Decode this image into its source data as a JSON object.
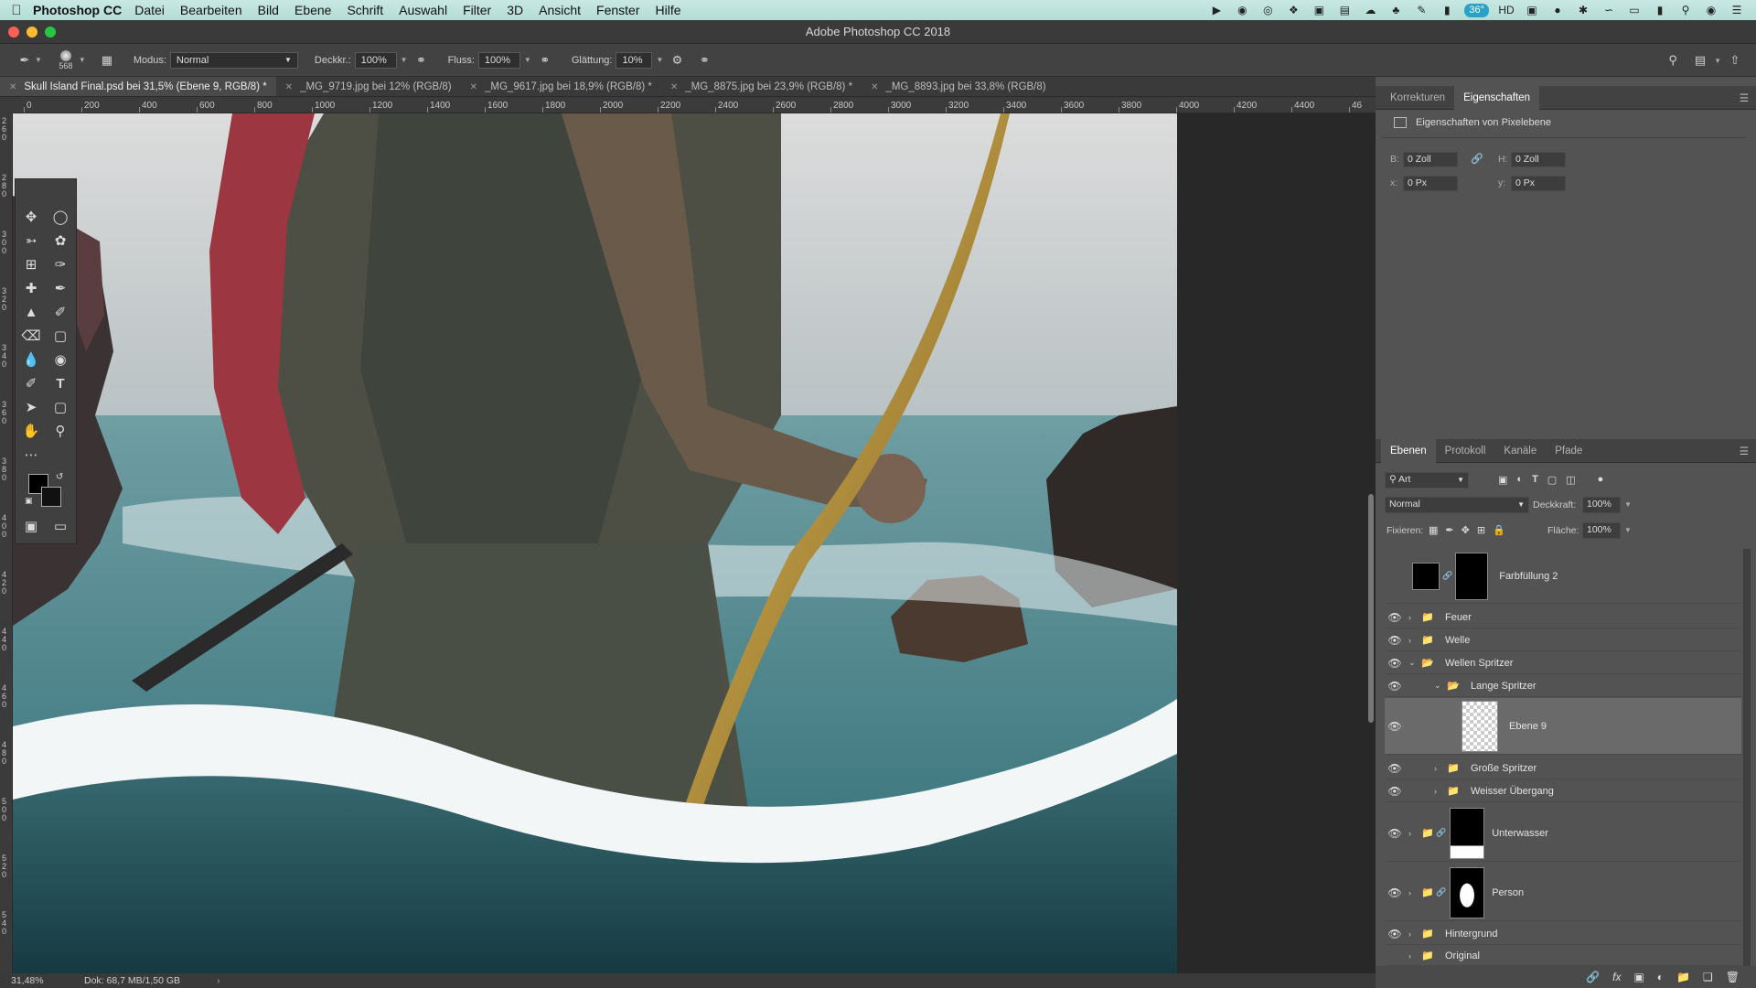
{
  "menubar": {
    "app_name": "Photoshop CC",
    "items": [
      "Datei",
      "Bearbeiten",
      "Bild",
      "Ebene",
      "Schrift",
      "Auswahl",
      "Filter",
      "3D",
      "Ansicht",
      "Fenster",
      "Hilfe"
    ],
    "temperature": "36°",
    "status_icons": [
      "airplay-icon",
      "record-icon",
      "vpn-icon",
      "dropbox-icon",
      "monitor-icon",
      "display-icon",
      "creative-cloud-icon",
      "evernote-icon",
      "pen-icon",
      "bookmark-icon",
      "hd-icon",
      "camera-icon",
      "dot-icon",
      "bluetooth-icon",
      "wifi-icon",
      "airplay-display-icon",
      "battery-icon",
      "search-icon",
      "siri-icon",
      "list-icon"
    ]
  },
  "window": {
    "title": "Adobe Photoshop CC 2018"
  },
  "options_bar": {
    "brush_size": "568",
    "mode_label": "Modus:",
    "mode_value": "Normal",
    "opacity_label": "Deckkr.:",
    "opacity_value": "100%",
    "flow_label": "Fluss:",
    "flow_value": "100%",
    "smoothing_label": "Glättung:",
    "smoothing_value": "10%"
  },
  "tabs": [
    {
      "label": "Skull Island Final.psd bei 31,5% (Ebene 9, RGB/8) *",
      "active": true
    },
    {
      "label": "_MG_9719.jpg bei 12% (RGB/8)",
      "active": false
    },
    {
      "label": "_MG_9617.jpg bei 18,9% (RGB/8) *",
      "active": false
    },
    {
      "label": "_MG_8875.jpg bei 23,9% (RGB/8) *",
      "active": false
    },
    {
      "label": "_MG_8893.jpg bei 33,8% (RGB/8)",
      "active": false
    }
  ],
  "ruler": {
    "top_labels": [
      "0",
      "200",
      "400",
      "600",
      "800",
      "1000",
      "1200",
      "1400",
      "1600",
      "1800",
      "2000",
      "2200",
      "2400",
      "2600",
      "2800",
      "3000",
      "3200",
      "3400",
      "3600",
      "3800",
      "4000",
      "4200",
      "4400",
      "46"
    ],
    "left_labels": [
      "2 6 0",
      "2 8 0",
      "3 0 0",
      "3 2 0",
      "3 4 0",
      "3 6 0",
      "3 8 0",
      "4 0 0",
      "4 2 0",
      "4 4 0",
      "4 6 0",
      "4 8 0",
      "5 0 0",
      "5 2 0",
      "5 4 0"
    ]
  },
  "status": {
    "zoom": "31,48%",
    "doc": "Dok: 68,7 MB/1,50 GB"
  },
  "properties_panel": {
    "tabs": [
      "Korrekturen",
      "Eigenschaften"
    ],
    "active_tab": "Eigenschaften",
    "heading": "Eigenschaften von Pixelebene",
    "w_label": "B:",
    "w_value": "0 Zoll",
    "h_label": "H:",
    "h_value": "0 Zoll",
    "x_label": "x:",
    "x_value": "0 Px",
    "y_label": "y:",
    "y_value": "0 Px"
  },
  "layers_panel": {
    "tabs": [
      "Ebenen",
      "Protokoll",
      "Kanäle",
      "Pfade"
    ],
    "active_tab": "Ebenen",
    "filter_value": "Art",
    "blend_mode": "Normal",
    "opacity_label": "Deckkraft:",
    "opacity_value": "100%",
    "lock_label": "Fixieren:",
    "fill_label": "Fläche:",
    "fill_value": "100%",
    "layers": [
      {
        "name": "Farbfüllung 2",
        "visible": false,
        "type": "fill",
        "indent": 0
      },
      {
        "name": "Feuer",
        "visible": true,
        "type": "group",
        "indent": 0
      },
      {
        "name": "Welle",
        "visible": true,
        "type": "group",
        "indent": 0
      },
      {
        "name": "Wellen Spritzer",
        "visible": true,
        "type": "group-open",
        "indent": 0
      },
      {
        "name": "Lange Spritzer",
        "visible": true,
        "type": "group-open",
        "indent": 1
      },
      {
        "name": "Ebene 9",
        "visible": true,
        "type": "pixel",
        "indent": 2,
        "selected": true
      },
      {
        "name": "Große Spritzer",
        "visible": true,
        "type": "group",
        "indent": 1
      },
      {
        "name": "Weisser Übergang",
        "visible": true,
        "type": "group",
        "indent": 1
      },
      {
        "name": "Unterwasser",
        "visible": true,
        "type": "group-mask",
        "indent": 0
      },
      {
        "name": "Person",
        "visible": true,
        "type": "group-mask",
        "indent": 0
      },
      {
        "name": "Hintergrund",
        "visible": true,
        "type": "group",
        "indent": 0
      },
      {
        "name": "Original",
        "visible": false,
        "type": "group",
        "indent": 0
      }
    ]
  }
}
